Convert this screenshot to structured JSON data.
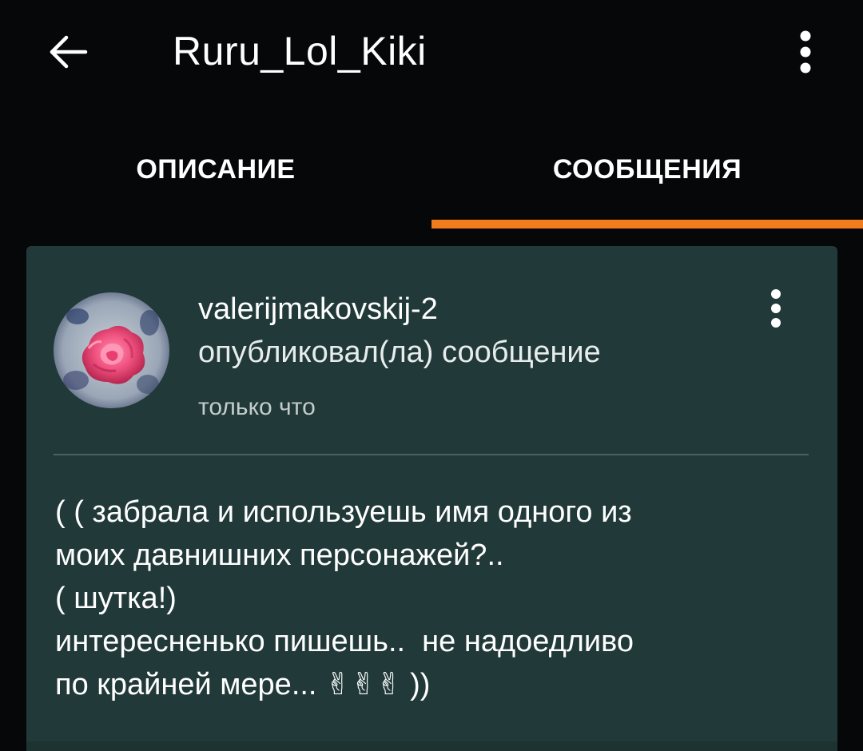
{
  "topbar": {
    "title": "Ruru_Lol_Kiki",
    "back_icon": "arrow-left-icon",
    "menu_icon": "more-vertical-icon"
  },
  "tabs": [
    {
      "label": "ОПИСАНИЕ",
      "active": false
    },
    {
      "label": "СООБЩЕНИЯ",
      "active": true
    }
  ],
  "colors": {
    "background": "#050708",
    "card": "#213a39",
    "accent": "#f07c1e",
    "divider": "#4a6362"
  },
  "post": {
    "username": "valerijmakovskij-2",
    "action": "опубликовал(ла) сообщение",
    "time": "только что",
    "avatar_icon": "rose-avatar",
    "menu_icon": "more-vertical-icon",
    "message_lines": [
      "( ( забрала и используешь имя одного из",
      "моих давнишних персонажей?..",
      "( шутка!)",
      "интересненько пишешь..  не надоедливо",
      "по крайней мере... ✌✌✌ ))"
    ]
  }
}
